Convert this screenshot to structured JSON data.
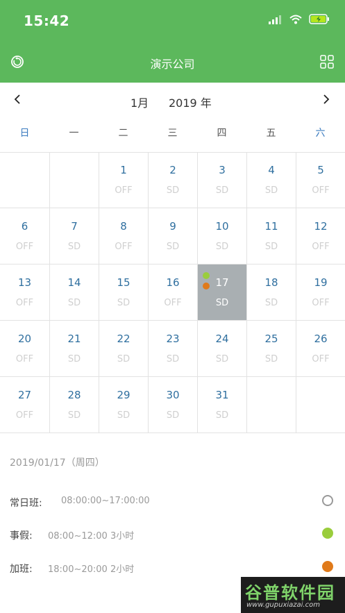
{
  "status_bar": {
    "time": "15:42"
  },
  "nav": {
    "title": "演示公司",
    "refresh_icon": "refresh-icon",
    "grid_icon": "grid-icon"
  },
  "month_bar": {
    "month": "1月",
    "year": "2019 年"
  },
  "weekdays": [
    "日",
    "一",
    "二",
    "三",
    "四",
    "五",
    "六"
  ],
  "days": [
    {
      "n": "",
      "s": ""
    },
    {
      "n": "",
      "s": ""
    },
    {
      "n": "1",
      "s": "OFF"
    },
    {
      "n": "2",
      "s": "SD"
    },
    {
      "n": "3",
      "s": "SD"
    },
    {
      "n": "4",
      "s": "SD"
    },
    {
      "n": "5",
      "s": "OFF"
    },
    {
      "n": "6",
      "s": "OFF"
    },
    {
      "n": "7",
      "s": "SD"
    },
    {
      "n": "8",
      "s": "OFF"
    },
    {
      "n": "9",
      "s": "SD"
    },
    {
      "n": "10",
      "s": "SD"
    },
    {
      "n": "11",
      "s": "SD"
    },
    {
      "n": "12",
      "s": "OFF"
    },
    {
      "n": "13",
      "s": "OFF"
    },
    {
      "n": "14",
      "s": "SD"
    },
    {
      "n": "15",
      "s": "SD"
    },
    {
      "n": "16",
      "s": "OFF"
    },
    {
      "n": "17",
      "s": "SD"
    },
    {
      "n": "18",
      "s": "SD"
    },
    {
      "n": "19",
      "s": "OFF"
    },
    {
      "n": "20",
      "s": "OFF"
    },
    {
      "n": "21",
      "s": "SD"
    },
    {
      "n": "22",
      "s": "SD"
    },
    {
      "n": "23",
      "s": "SD"
    },
    {
      "n": "24",
      "s": "SD"
    },
    {
      "n": "25",
      "s": "SD"
    },
    {
      "n": "26",
      "s": "OFF"
    },
    {
      "n": "27",
      "s": "OFF"
    },
    {
      "n": "28",
      "s": "SD"
    },
    {
      "n": "29",
      "s": "SD"
    },
    {
      "n": "30",
      "s": "SD"
    },
    {
      "n": "31",
      "s": "SD"
    },
    {
      "n": "",
      "s": ""
    },
    {
      "n": "",
      "s": ""
    }
  ],
  "selected_day": "17",
  "selected_day_dots": [
    "#9acd3c",
    "#e07a1a"
  ],
  "details": {
    "date": "2019/01/17（周四）",
    "events": [
      {
        "label": "常日班:",
        "time": "08:00:00~17:00:00",
        "color": "#ffffff",
        "border": "#999999"
      },
      {
        "label": "事假:",
        "time": "08:00~12:00 3小时",
        "color": "#9acd3c",
        "border": "#9acd3c"
      },
      {
        "label": "加班:",
        "time": "18:00~20:00 2小时",
        "color": "#e07a1a",
        "border": "#e07a1a"
      }
    ]
  },
  "colors": {
    "header": "#5cb85c",
    "weekend": "#3b7bbf",
    "day_number": "#2f6f9f",
    "selected_bg": "#a9afb2"
  },
  "watermark": {
    "text": "谷普软件园",
    "url": "www.gupuxiazai.com"
  }
}
